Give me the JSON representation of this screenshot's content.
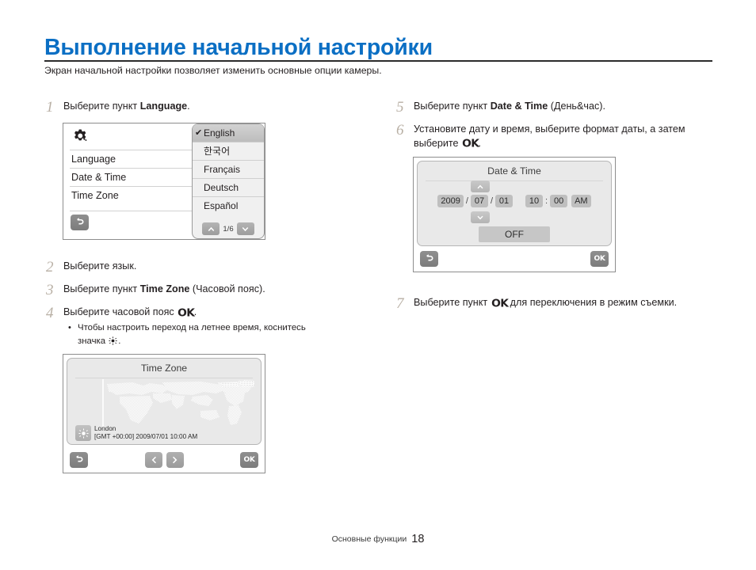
{
  "document": {
    "title": "Выполнение начальной настройки",
    "subtitle": "Экран начальной настройки позволяет изменить основные опции камеры.",
    "title_color": "#0b6fc4",
    "footer_label": "Основные функции",
    "page_number": "18"
  },
  "steps": {
    "s1": {
      "num": "1",
      "pre": "Выберите пункт ",
      "bold": "Language",
      "post": "."
    },
    "s2": {
      "num": "2",
      "pre": "Выберите язык.",
      "bold": "",
      "post": ""
    },
    "s3": {
      "num": "3",
      "pre": "Выберите пункт ",
      "bold": "Time Zone",
      "post": " (Часовой пояс)."
    },
    "s4": {
      "num": "4",
      "pre": "Выберите часовой пояс ",
      "ok": "OK",
      "post": ".",
      "bullet_pre": "Чтобы настроить переход на летнее время, коснитесь значка ",
      "bullet_post": "."
    },
    "s5": {
      "num": "5",
      "pre": "Выберите пункт ",
      "bold": "Date & Time",
      "post": " (День&час)."
    },
    "s6": {
      "num": "6",
      "pre": "Установите дату и время, выберите формат даты, а затем выберите ",
      "ok": "OK",
      "post": "."
    },
    "s7": {
      "num": "7",
      "pre": "Выберите пункт ",
      "ok": "OK",
      "post": " для переключения в режим съемки."
    }
  },
  "screen_language": {
    "menu_items": [
      "Language",
      "Date & Time",
      "Time Zone"
    ],
    "gear_icon": "gear-icon",
    "back_icon": "back-arrow-icon",
    "languages": [
      {
        "label": "English",
        "selected": true,
        "check": "✔"
      },
      {
        "label": "한국어",
        "selected": false,
        "check": ""
      },
      {
        "label": "Français",
        "selected": false,
        "check": ""
      },
      {
        "label": "Deutsch",
        "selected": false,
        "check": ""
      },
      {
        "label": "Español",
        "selected": false,
        "check": ""
      }
    ],
    "pager": {
      "up_icon": "chevron-up-icon",
      "down_icon": "chevron-down-icon",
      "page": "1/6"
    }
  },
  "screen_timezone": {
    "title": "Time Zone",
    "city": "London",
    "gmt_line": "[GMT +00:00] 2009/07/01 10:00 AM",
    "sun_icon": "sun-icon",
    "back_icon": "back-arrow-icon",
    "prev_icon": "chevron-left-icon",
    "next_icon": "chevron-right-icon",
    "ok_label": "OK"
  },
  "screen_datetime": {
    "title": "Date & Time",
    "year": "2009",
    "month": "07",
    "day": "01",
    "hour": "10",
    "minute": "00",
    "meridiem": "AM",
    "date_sep": "/",
    "time_sep": ":",
    "dst_label": "OFF",
    "up_icon": "chevron-up-icon",
    "down_icon": "chevron-down-icon",
    "back_icon": "back-arrow-icon",
    "ok_label": "OK"
  }
}
